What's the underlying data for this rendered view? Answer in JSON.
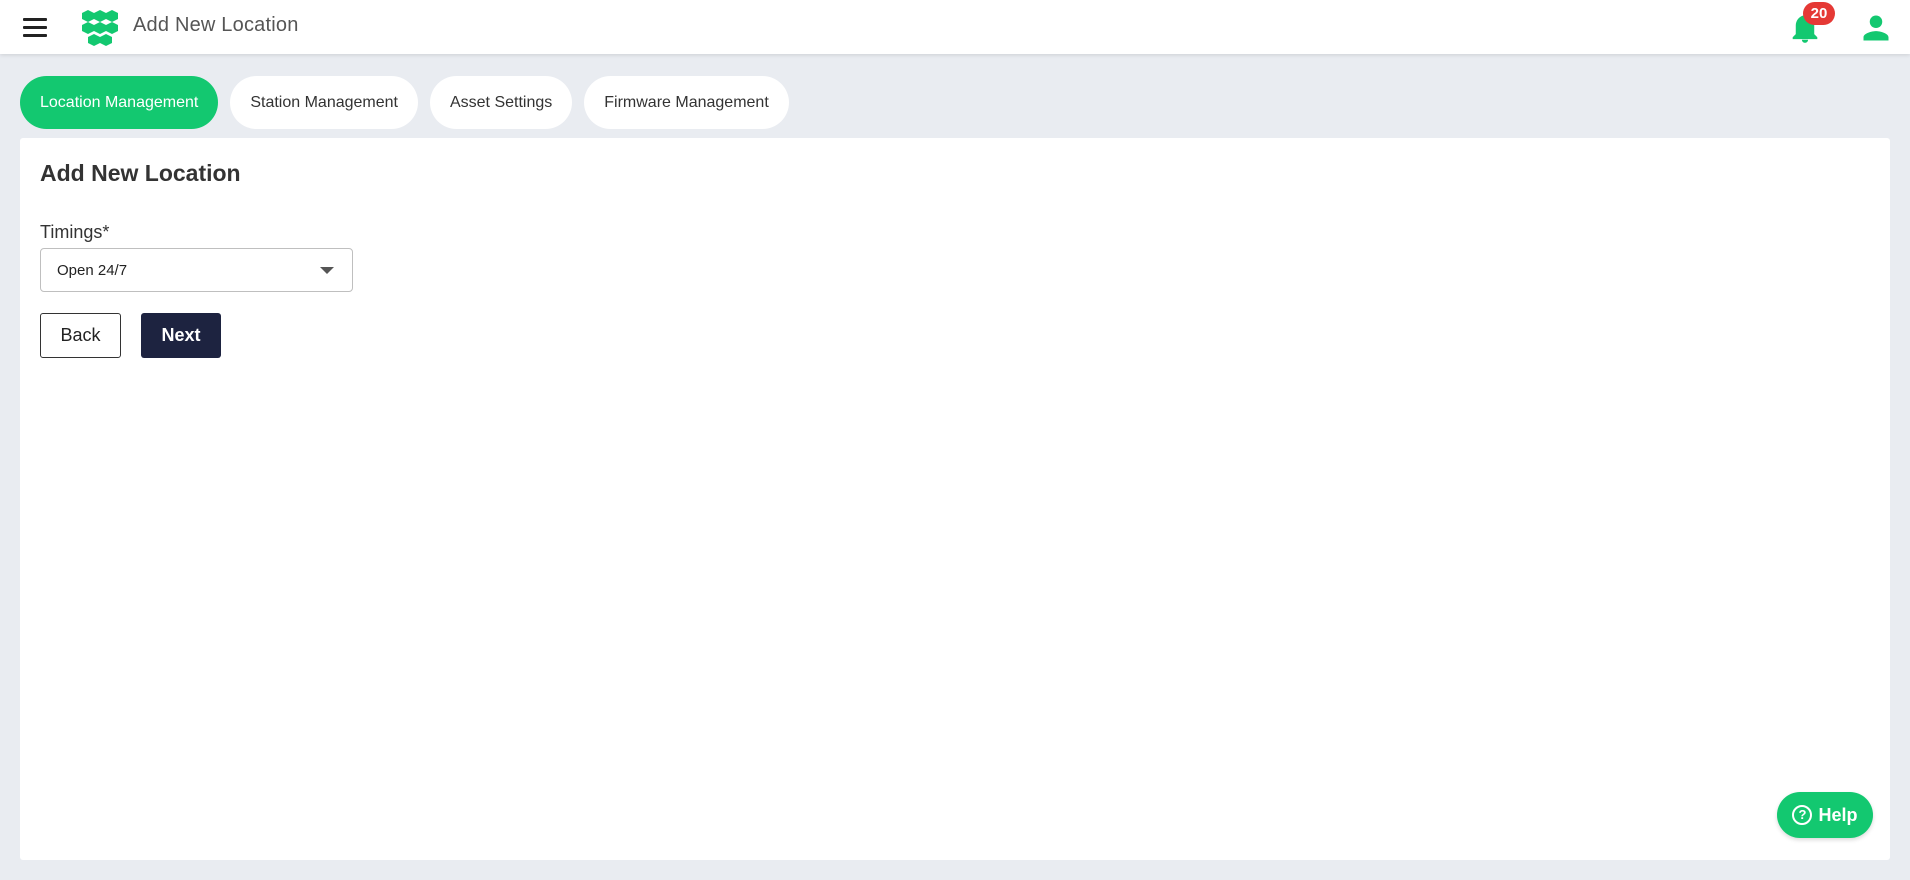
{
  "header": {
    "title": "Add New Location",
    "notification_count": "20",
    "icons": {
      "menu": "hamburger-menu-icon",
      "logo": "hexagon-cluster-logo",
      "notifications": "bell-icon",
      "user": "user-icon"
    }
  },
  "tabs": [
    {
      "label": "Location Management",
      "active": true
    },
    {
      "label": "Station Management",
      "active": false
    },
    {
      "label": "Asset Settings",
      "active": false
    },
    {
      "label": "Firmware Management",
      "active": false
    }
  ],
  "form": {
    "heading": "Add New Location",
    "timings_label": "Timings*",
    "timings_value": "Open 24/7",
    "back_label": "Back",
    "next_label": "Next"
  },
  "help": {
    "label": "Help",
    "icon_glyph": "?"
  },
  "colors": {
    "accent": "#13c870",
    "primary_button": "#1d2340",
    "badge": "#e53935",
    "page_background": "#e9ecf1"
  }
}
